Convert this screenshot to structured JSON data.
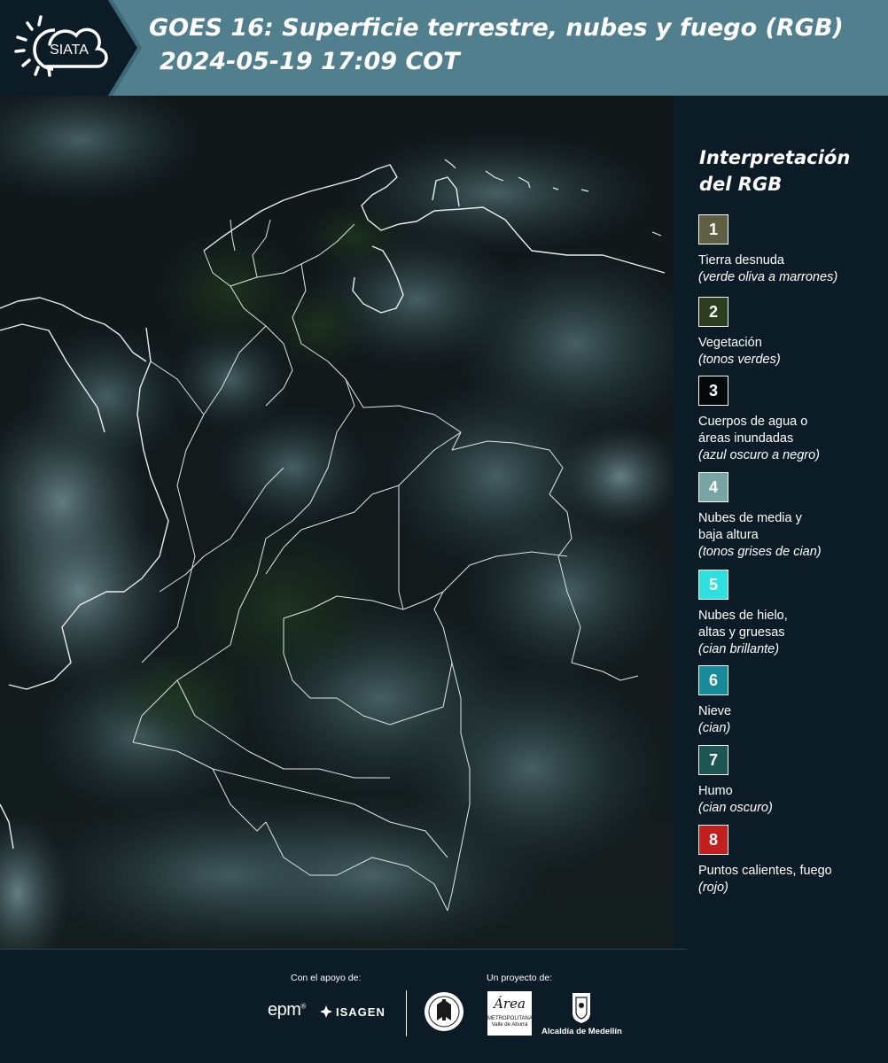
{
  "header": {
    "logo_text": "SIATA",
    "title": "GOES 16: Superficie terrestre, nubes y fuego (RGB)",
    "subtitle": "2024-05-19 17:09 COT"
  },
  "legend": {
    "title": "Interpretación\ndel RGB",
    "items": [
      {
        "number": "1",
        "label": "Tierra desnuda",
        "note": "(verde oliva a marrones)",
        "color": "#5f5f43"
      },
      {
        "number": "2",
        "label": "Vegetación",
        "note": "(tonos verdes)",
        "color": "#2b3f1f"
      },
      {
        "number": "3",
        "label": "Cuerpos de agua o\náreas inundadas",
        "note": "(azul oscuro a negro)",
        "color": "#05090b"
      },
      {
        "number": "4",
        "label": "Nubes de media y\nbaja altura",
        "note": "(tonos grises de cian)",
        "color": "#78a5a4"
      },
      {
        "number": "5",
        "label": "Nubes de hielo,\naltas y gruesas",
        "note": "(cian brillante)",
        "color": "#2fe0e0"
      },
      {
        "number": "6",
        "label": "Nieve",
        "note": "(cian)",
        "color": "#178b9c"
      },
      {
        "number": "7",
        "label": "Humo",
        "note": "(cian oscuro)",
        "color": "#1d5555"
      },
      {
        "number": "8",
        "label": "Puntos calientes, fuego",
        "note": "(rojo)",
        "color": "#c21f1f"
      }
    ]
  },
  "footer": {
    "support_label": "Con el apoyo de:",
    "project_label": "Un proyecto de:",
    "epm": "epm",
    "isagen": "ISAGEN",
    "area_script": "Área",
    "area_text": "METROPOLITANA",
    "area_sub": "Valle de Aburrá",
    "alcaldia": "Alcaldía de Medellín"
  },
  "colors": {
    "header_bg": "#517f8e",
    "logo_bg": "#0c1c27",
    "page_bg": "#0c1c27"
  }
}
